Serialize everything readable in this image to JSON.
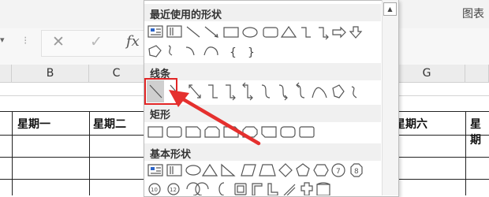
{
  "ribbon": {
    "right_label": "图表"
  },
  "formula_bar": {
    "cancel_glyph": "✕",
    "enter_glyph": "✓",
    "fx_label": "fx",
    "name_arrow": "▾",
    "grip": "⁝"
  },
  "columns": [
    {
      "label": "B"
    },
    {
      "label": "C"
    },
    {
      "label": "G"
    }
  ],
  "cells": {
    "mon": "星期一",
    "tue": "星期二",
    "sat": "星期六",
    "sun": "星期"
  },
  "shapes_menu": {
    "sections": {
      "recent": "最近使用的形状",
      "lines": "线条",
      "rectangles": "矩形",
      "basic": "基本形状"
    },
    "scroll_up_glyph": "▲"
  },
  "colors": {
    "highlight": "#e22626",
    "arrow": "#e5302e"
  }
}
